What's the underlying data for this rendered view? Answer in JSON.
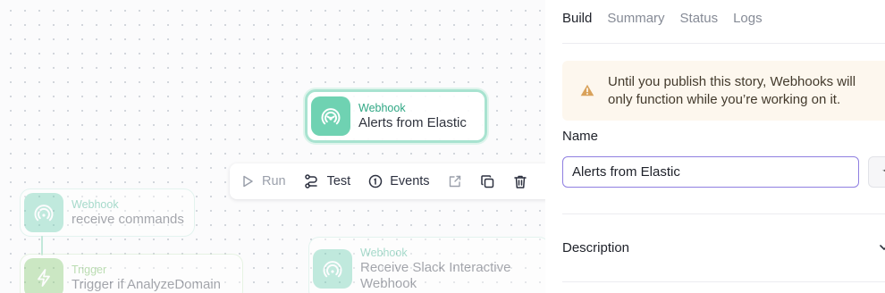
{
  "canvas": {
    "nodes": [
      {
        "kind": "Webhook",
        "name": "Alerts from Elastic"
      },
      {
        "kind": "Webhook",
        "name": "receive commands"
      },
      {
        "kind": "Trigger",
        "name": "Trigger if AnalyzeDomain"
      },
      {
        "kind": "Webhook",
        "name": "Receive Slack Interactive Webhook"
      }
    ],
    "toolbar": {
      "run_label": "Run",
      "test_label": "Test",
      "events_label": "Events"
    }
  },
  "panel": {
    "tabs": [
      "Build",
      "Summary",
      "Status",
      "Logs"
    ],
    "active_tab": "Build",
    "banner_text": "Until you publish this story, Webhooks will only function while you’re working on it.",
    "name_label": "Name",
    "name_value": "Alerts from Elastic",
    "description_label": "Description"
  },
  "colors": {
    "webhook": "#6fd2b2",
    "trigger": "#92d17f",
    "focus_border": "#8f7fe1",
    "banner_bg": "#fdf7ee",
    "warning": "#d9a25b"
  },
  "icons": {
    "webhook": "broadcast-icon",
    "trigger": "lightning-icon",
    "run": "play-icon",
    "test": "branch-icon",
    "events": "info-circle-icon",
    "export": "export-icon",
    "duplicate": "copy-icon",
    "delete": "trash-icon",
    "warning": "warning-triangle-icon",
    "description": "chevron-down-icon"
  }
}
